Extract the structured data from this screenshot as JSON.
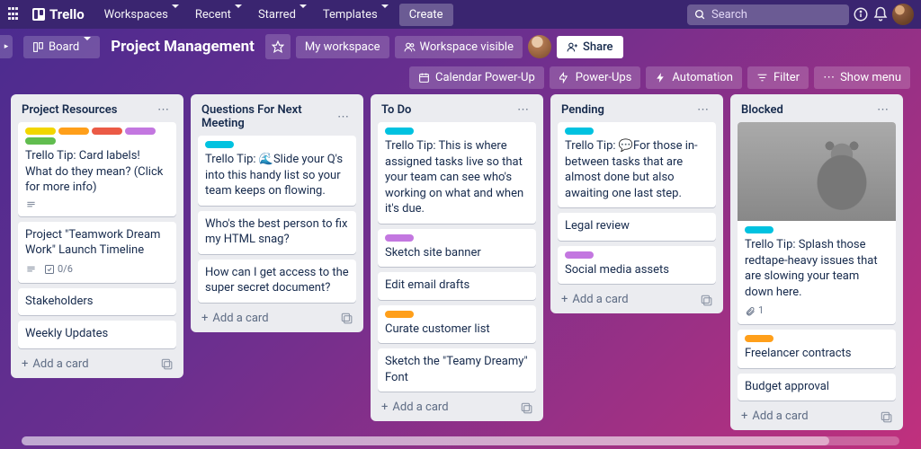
{
  "colors": {
    "yellow": "#f2d600",
    "orange": "#ff9f1a",
    "red": "#eb5a46",
    "purple": "#c377e0",
    "green": "#61bd4f",
    "sky": "#00c2e0"
  },
  "topnav": {
    "logo": "Trello",
    "items": [
      "Workspaces",
      "Recent",
      "Starred",
      "Templates"
    ],
    "create": "Create",
    "search_placeholder": "Search"
  },
  "boardbar": {
    "board_btn": "Board",
    "title": "Project Management",
    "workspace": "My workspace",
    "visibility": "Workspace visible",
    "share": "Share"
  },
  "actionbar": {
    "calendar": "Calendar Power-Up",
    "powerups": "Power-Ups",
    "automation": "Automation",
    "filter": "Filter",
    "menu": "Show menu"
  },
  "add_card": "Add a card",
  "lists": [
    {
      "title": "Project Resources",
      "cards": [
        {
          "labels": [
            "yellow",
            "orange",
            "red",
            "purple",
            "green"
          ],
          "text": "Trello Tip: Card labels! What do they mean? (Click for more info)",
          "badges": {
            "desc": true
          }
        },
        {
          "text": "Project \"Teamwork Dream Work\" Launch Timeline",
          "badges": {
            "desc": true,
            "checklist": "0/6"
          }
        },
        {
          "text": "Stakeholders"
        },
        {
          "text": "Weekly Updates"
        }
      ]
    },
    {
      "title": "Questions For Next Meeting",
      "cards": [
        {
          "labels": [
            "sky"
          ],
          "text": "Trello Tip: 🌊Slide your Q's into this handy list so your team keeps on flowing."
        },
        {
          "text": "Who's the best person to fix my HTML snag?"
        },
        {
          "text": "How can I get access to the super secret document?"
        }
      ]
    },
    {
      "title": "To Do",
      "cards": [
        {
          "labels": [
            "sky"
          ],
          "text": "Trello Tip: This is where assigned tasks live so that your team can see who's working on what and when it's due."
        },
        {
          "labels": [
            "purple"
          ],
          "text": "Sketch site banner"
        },
        {
          "text": "Edit email drafts"
        },
        {
          "labels": [
            "orange"
          ],
          "text": "Curate customer list"
        },
        {
          "text": "Sketch the \"Teamy Dreamy\" Font"
        }
      ]
    },
    {
      "title": "Pending",
      "cards": [
        {
          "labels": [
            "sky"
          ],
          "text": "Trello Tip: 💬For those in-between tasks that are almost done but also awaiting one last step."
        },
        {
          "text": "Legal review"
        },
        {
          "labels": [
            "purple"
          ],
          "text": "Social media assets"
        }
      ]
    },
    {
      "title": "Blocked",
      "cards": [
        {
          "cover": true,
          "labels": [
            "sky"
          ],
          "text": "Trello Tip: Splash those redtape-heavy issues that are slowing your team down here.",
          "badges": {
            "attach": "1"
          }
        },
        {
          "labels": [
            "orange"
          ],
          "text": "Freelancer contracts"
        },
        {
          "text": "Budget approval"
        }
      ]
    }
  ]
}
